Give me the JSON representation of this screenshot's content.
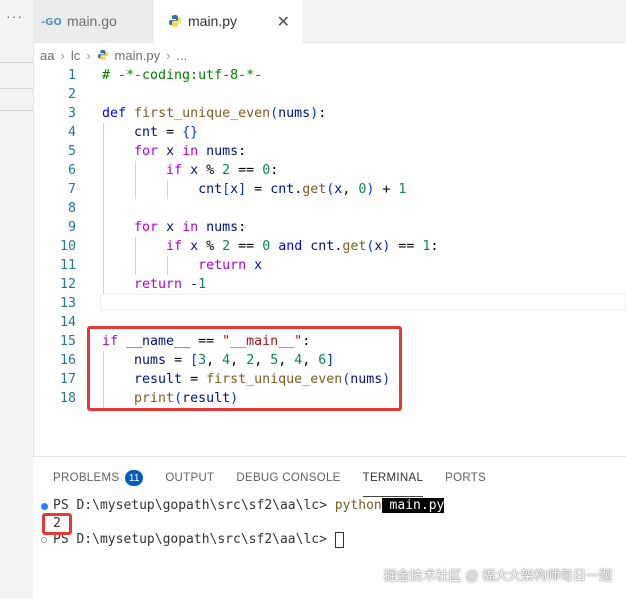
{
  "tabs": [
    {
      "label": "main.go",
      "active": false,
      "icon": "go-file-icon"
    },
    {
      "label": "main.py",
      "active": true,
      "icon": "python-file-icon"
    }
  ],
  "breadcrumb": [
    "aa",
    "lc",
    "main.py",
    "..."
  ],
  "editor": {
    "lines": [
      {
        "n": "1"
      },
      {
        "n": "2"
      },
      {
        "n": "3"
      },
      {
        "n": "4"
      },
      {
        "n": "5"
      },
      {
        "n": "6"
      },
      {
        "n": "7"
      },
      {
        "n": "8"
      },
      {
        "n": "9"
      },
      {
        "n": "10"
      },
      {
        "n": "11"
      },
      {
        "n": "12"
      },
      {
        "n": "13"
      },
      {
        "n": "14"
      },
      {
        "n": "15"
      },
      {
        "n": "16"
      },
      {
        "n": "17"
      },
      {
        "n": "18"
      }
    ],
    "code": {
      "l1": "# -*-coding:utf-8-*-",
      "l3_def": "def",
      "l3_fn": "first_unique_even",
      "l3_param": "nums",
      "l4_var": "cnt",
      "l5_for": "for",
      "l5_x": "x",
      "l5_in": "in",
      "l5_nums": "nums",
      "l6_if": "if",
      "l6_cond": "x % 2 == 0:",
      "l7_a": "cnt",
      "l7_b": "x",
      "l7_c": "cnt",
      "l7_get": "get",
      "l7_args": "x, 0",
      "l7_plus": "+ 1",
      "l9_for": "for",
      "l9_x": "x",
      "l9_in": "in",
      "l9_nums": "nums",
      "l10_if": "if",
      "l10_a": "x % 2 == 0",
      "l10_and": "and",
      "l10_cnt": "cnt",
      "l10_get": "get",
      "l10_x": "x",
      "l10_eq": "== 1:",
      "l11_ret": "return",
      "l11_x": "x",
      "l12_ret": "return",
      "l12_v": "-1",
      "l15_if": "if",
      "l15_name": "__name__",
      "l15_eq": "==",
      "l15_str": "\"__main__\"",
      "l16_var": "nums",
      "l16_list": "3, 4, 2, 5, 4, 6",
      "l17_var": "result",
      "l17_fn": "first_unique_even",
      "l17_arg": "nums",
      "l18_fn": "print",
      "l18_arg": "result"
    }
  },
  "panel": {
    "tabs": [
      "PROBLEMS",
      "OUTPUT",
      "DEBUG CONSOLE",
      "TERMINAL",
      "PORTS"
    ],
    "problems_count": "11",
    "active_tab": "TERMINAL"
  },
  "terminal": {
    "prompt1": "PS D:\\mysetup\\gopath\\src\\sf2\\aa\\lc> ",
    "command": "python",
    "arg": " main.py",
    "output": "2",
    "prompt2": "PS D:\\mysetup\\gopath\\src\\sf2\\aa\\lc> "
  },
  "watermark": "掘金技术社区 @ 福大大架构师每日一题",
  "colors": {
    "accent": "#005fb8",
    "highlight_box": "#e53935"
  }
}
